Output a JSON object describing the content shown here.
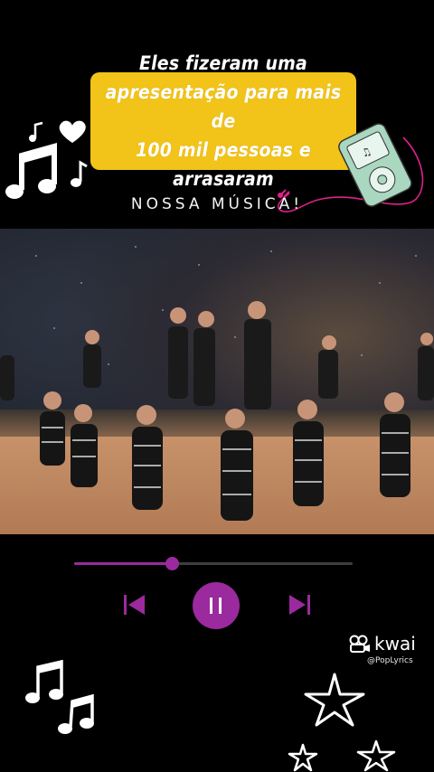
{
  "caption": {
    "text": "Eles fizeram uma\napresentação para mais de\n100 mil pessoas e arrasaram"
  },
  "subtitle": "NOSSA MÚSICA!",
  "player": {
    "progress": 0.35,
    "accent_color": "#9b2a9e",
    "caption_color": "#f2c318"
  },
  "watermark": {
    "brand": "kwai",
    "handle": "@PopLyrics"
  },
  "icons": {
    "music_notes_top": "music-notes-icon",
    "heart": "heart-icon",
    "ipod": "ipod-icon",
    "music_notes_bottom": "music-notes-icon",
    "stars": "star-icon",
    "prev": "skip-previous-icon",
    "pause": "pause-icon",
    "next": "skip-next-icon"
  }
}
